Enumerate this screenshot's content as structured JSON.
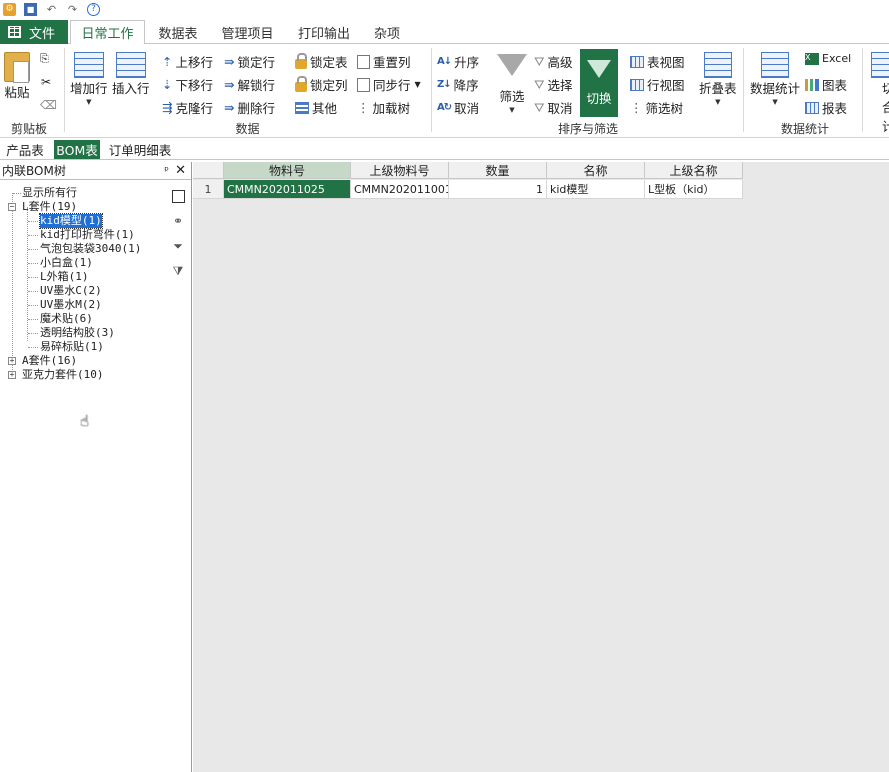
{
  "qat": {
    "icons": [
      "app-icon",
      "save-icon",
      "undo-icon",
      "redo-icon",
      "help-icon"
    ]
  },
  "ribbon_tabs": {
    "file": "文件",
    "tabs": [
      "日常工作",
      "数据表",
      "管理项目",
      "打印输出",
      "杂项"
    ]
  },
  "ribbon": {
    "clipboard": {
      "paste": "粘贴",
      "label": "剪贴板"
    },
    "data": {
      "add_row": "增加行",
      "insert_row": "插入行",
      "move_up": "上移行",
      "move_down": "下移行",
      "clone_row": "克隆行",
      "lock_row": "锁定行",
      "unlock_row": "解锁行",
      "delete_row": "删除行",
      "lock_table": "锁定表",
      "lock_col": "锁定列",
      "other": "其他",
      "reset_col": "重置列",
      "sync_row": "同步行",
      "load_tree": "加载树",
      "label": "数据"
    },
    "sort": {
      "asc": "升序",
      "desc": "降序",
      "cancel": "取消",
      "filter": "筛选",
      "advanced": "高级",
      "select": "选择",
      "cancel2": "取消",
      "switch": "切换",
      "table_view": "表视图",
      "row_view": "行视图",
      "filter_tree": "筛选树",
      "fold_table": "折叠表",
      "label": "排序与筛选"
    },
    "stats": {
      "data_stats": "数据统计",
      "excel": "Excel",
      "chart": "图表",
      "report": "报表",
      "label": "数据统计",
      "partial1": "切",
      "partial2": "合计"
    }
  },
  "subtabs": [
    "产品表",
    "BOM表",
    "订单明细表"
  ],
  "panel": {
    "title": "内联BOM树",
    "pin": "ᵖ",
    "close": "✕"
  },
  "tree": {
    "show_all": "显示所有行",
    "nodes": [
      {
        "label": "L套件(19)",
        "children": [
          "kid模型(1)",
          "kid打印折弯件(1)",
          "气泡包装袋3040(1)",
          "小白盒(1)",
          "L外箱(1)",
          "UV墨水C(2)",
          "UV墨水M(2)",
          "魔术贴(6)",
          "透明结构胶(3)",
          "易碎标贴(1)"
        ]
      },
      {
        "label": "A套件(16)"
      },
      {
        "label": "亚克力套件(10)"
      }
    ]
  },
  "grid": {
    "columns": [
      "物料号",
      "上级物料号",
      "数量",
      "名称",
      "上级名称"
    ],
    "rows": [
      {
        "n": "1",
        "cells": [
          "CMMN202011025",
          "CMMN202011001",
          "1",
          "kid模型",
          "L型板（kid）"
        ]
      }
    ]
  },
  "colors": {
    "accent": "#217346",
    "selection": "#1e6fd6"
  }
}
